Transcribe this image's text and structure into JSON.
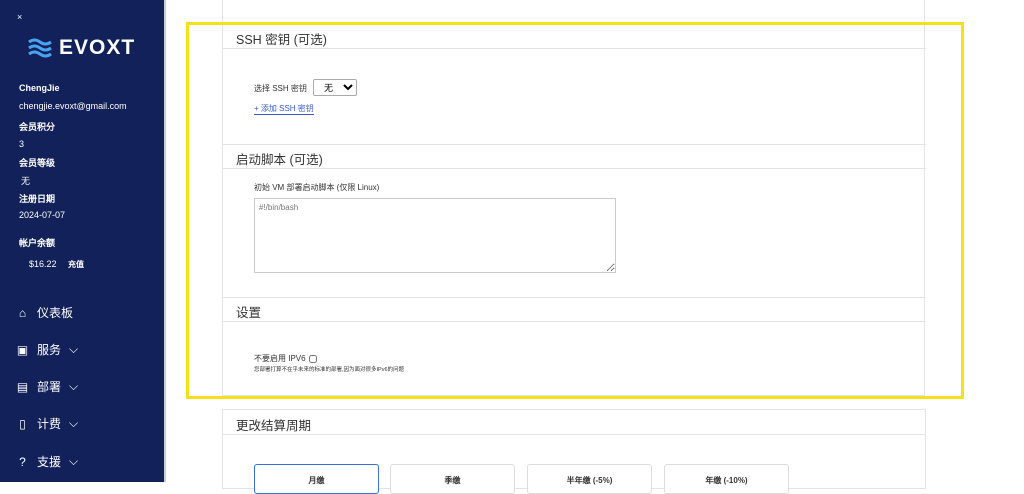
{
  "sidebar": {
    "close": "×",
    "brand": "EVOXT",
    "username": "ChengJie",
    "email": "chengjie.evoxt@gmail.com",
    "points_label": "会员积分",
    "points": "3",
    "level_label": "会员等级",
    "level": "无",
    "reg_label": "注册日期",
    "reg_date": "2024-07-07",
    "balance_label": "帐户余额",
    "balance": "$16.22",
    "recharge": "充值",
    "nav": [
      {
        "label": "仪表板",
        "icon": "home-icon"
      },
      {
        "label": "服务",
        "icon": "box-icon"
      },
      {
        "label": "部署",
        "icon": "calendar-icon"
      },
      {
        "label": "计费",
        "icon": "document-icon"
      },
      {
        "label": "支援",
        "icon": "help-icon"
      }
    ]
  },
  "ssh": {
    "title": "SSH 密钥 (可选)",
    "select_label": "选择 SSH 密钥",
    "select_value": "无",
    "add_link": "+ 添加 SSH 密钥"
  },
  "script": {
    "title": "启动脚本 (可选)",
    "label": "初始 VM 部署启动脚本 (仅限 Linux)",
    "placeholder": "#!/bin/bash"
  },
  "settings": {
    "title": "设置",
    "ipv6_label": "不要启用 IPV6",
    "ipv6_note": "您部署打算不在乎未来的标准的部署,因为面对很多IPv6的问题"
  },
  "billing": {
    "title": "更改结算周期",
    "options": [
      "月缴",
      "季缴",
      "半年缴 (-5%)",
      "年缴 (-10%)"
    ]
  }
}
